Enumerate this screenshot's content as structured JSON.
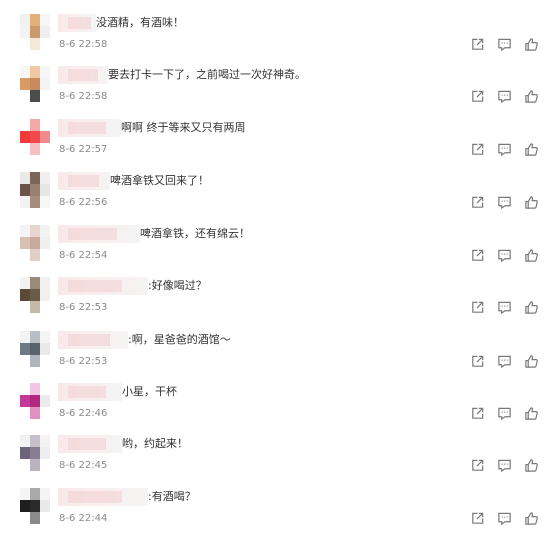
{
  "comments": [
    {
      "text": "没酒精，有酒味！",
      "time": "8-6 22:58",
      "avatar": [
        "#f1f1f1",
        "#e3b07a",
        "#f6f6f6",
        "#f3f3f3",
        "#c99a6a",
        "#efefef",
        "#ffffff",
        "#f4e8d8",
        "#ffffff"
      ]
    },
    {
      "text": "要去打卡一下了，之前喝过一次好神奇。",
      "time": "8-6 22:58",
      "avatar": [
        "#f6f6f6",
        "#f0c9a0",
        "#f6f6f6",
        "#d69b66",
        "#c98a5e",
        "#f3f3f3",
        "#ffffff",
        "#4c4c4c",
        "#ffffff"
      ]
    },
    {
      "text": "啊啊 终于等来又只有两周",
      "time": "8-6 22:57",
      "avatar": [
        "#ffffff",
        "#f4a9a9",
        "#ffffff",
        "#ef3b3b",
        "#f24a4a",
        "#f18a8a",
        "#ffffff",
        "#f6c0c0",
        "#ffffff"
      ]
    },
    {
      "text": "啤酒拿铁又回来了！",
      "time": "8-6 22:56",
      "avatar": [
        "#e9e9e9",
        "#7a6558",
        "#efefef",
        "#6a544a",
        "#9a8072",
        "#e6e6e6",
        "#f2f2f2",
        "#a58c7e",
        "#f6f6f6"
      ]
    },
    {
      "text": "啤酒拿铁，还有绵云！",
      "time": "8-6 22:54",
      "avatar": [
        "#f4f4f4",
        "#e8d6cf",
        "#f3f3f3",
        "#d8c0b5",
        "#c7aa9c",
        "#efefef",
        "#ffffff",
        "#e2cfc6",
        "#ffffff"
      ]
    },
    {
      "text": ":好像喝过？",
      "time": "8-6 22:53",
      "avatar": [
        "#f3f3f3",
        "#9a8a7a",
        "#f1f1f1",
        "#5a4a3a",
        "#6b5a48",
        "#f0f0f0",
        "#ffffff",
        "#c7b9a9",
        "#ffffff"
      ]
    },
    {
      "text": ":啊，星爸爸的酒馆～",
      "time": "8-6 22:53",
      "avatar": [
        "#f3f3f3",
        "#b9bec4",
        "#f4f4f4",
        "#6e7a86",
        "#59636d",
        "#e9e9e9",
        "#ffffff",
        "#aeb5bc",
        "#ffffff"
      ]
    },
    {
      "text": "小星，干杯",
      "time": "8-6 22:46",
      "avatar": [
        "#ffffff",
        "#f0c6e4",
        "#ffffff",
        "#c2399a",
        "#b3287f",
        "#ebebeb",
        "#ffffff",
        "#e190c4",
        "#ffffff"
      ]
    },
    {
      "text": "哟，约起来！",
      "time": "8-6 22:45",
      "avatar": [
        "#f2f2f2",
        "#c5c0ca",
        "#f3f3f3",
        "#6c6478",
        "#887e94",
        "#eeeeee",
        "#ffffff",
        "#bab3c1",
        "#ffffff"
      ]
    },
    {
      "text": ":有酒喝？",
      "time": "8-6 22:44",
      "avatar": [
        "#f5f5f5",
        "#aaaaaa",
        "#f4f4f4",
        "#1e1e1e",
        "#2a2a2a",
        "#e9e9e9",
        "#ffffff",
        "#8a8a8a",
        "#ffffff"
      ]
    }
  ],
  "icons": [
    "share-icon",
    "reply-icon",
    "like-icon"
  ]
}
